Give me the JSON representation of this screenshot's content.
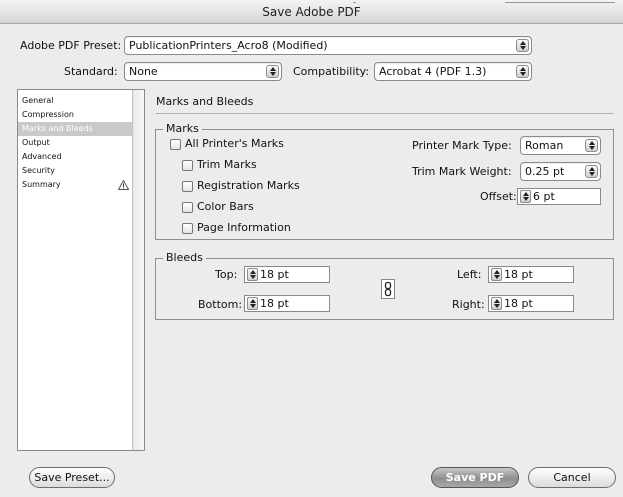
{
  "window": {
    "title": "Save Adobe PDF"
  },
  "preset": {
    "label": "Adobe PDF Preset:",
    "value": "PublicationPrinters_Acro8 (Modified)"
  },
  "standard": {
    "label": "Standard:",
    "value": "None"
  },
  "compatibility": {
    "label": "Compatibility:",
    "value": "Acrobat 4 (PDF 1.3)"
  },
  "sidebar": {
    "items": [
      {
        "label": "General"
      },
      {
        "label": "Compression"
      },
      {
        "label": "Marks and Bleeds"
      },
      {
        "label": "Output"
      },
      {
        "label": "Advanced"
      },
      {
        "label": "Security"
      },
      {
        "label": "Summary"
      }
    ],
    "selected": "Marks and Bleeds"
  },
  "section": {
    "title": "Marks and Bleeds"
  },
  "marks": {
    "group_title": "Marks",
    "all_printers": "All Printer's Marks",
    "trim": "Trim Marks",
    "registration": "Registration Marks",
    "color_bars": "Color Bars",
    "page_info": "Page Information",
    "printer_mark_type_label": "Printer Mark Type:",
    "printer_mark_type": "Roman",
    "trim_weight_label": "Trim Mark Weight:",
    "trim_weight": "0.25 pt",
    "offset_label": "Offset:",
    "offset": "6 pt"
  },
  "bleeds": {
    "group_title": "Bleeds",
    "top_label": "Top:",
    "top": "18 pt",
    "bottom_label": "Bottom:",
    "bottom": "18 pt",
    "left_label": "Left:",
    "left": "18 pt",
    "right_label": "Right:",
    "right": "18 pt"
  },
  "buttons": {
    "save_preset": "Save Preset...",
    "save_pdf": "Save PDF",
    "cancel": "Cancel"
  }
}
